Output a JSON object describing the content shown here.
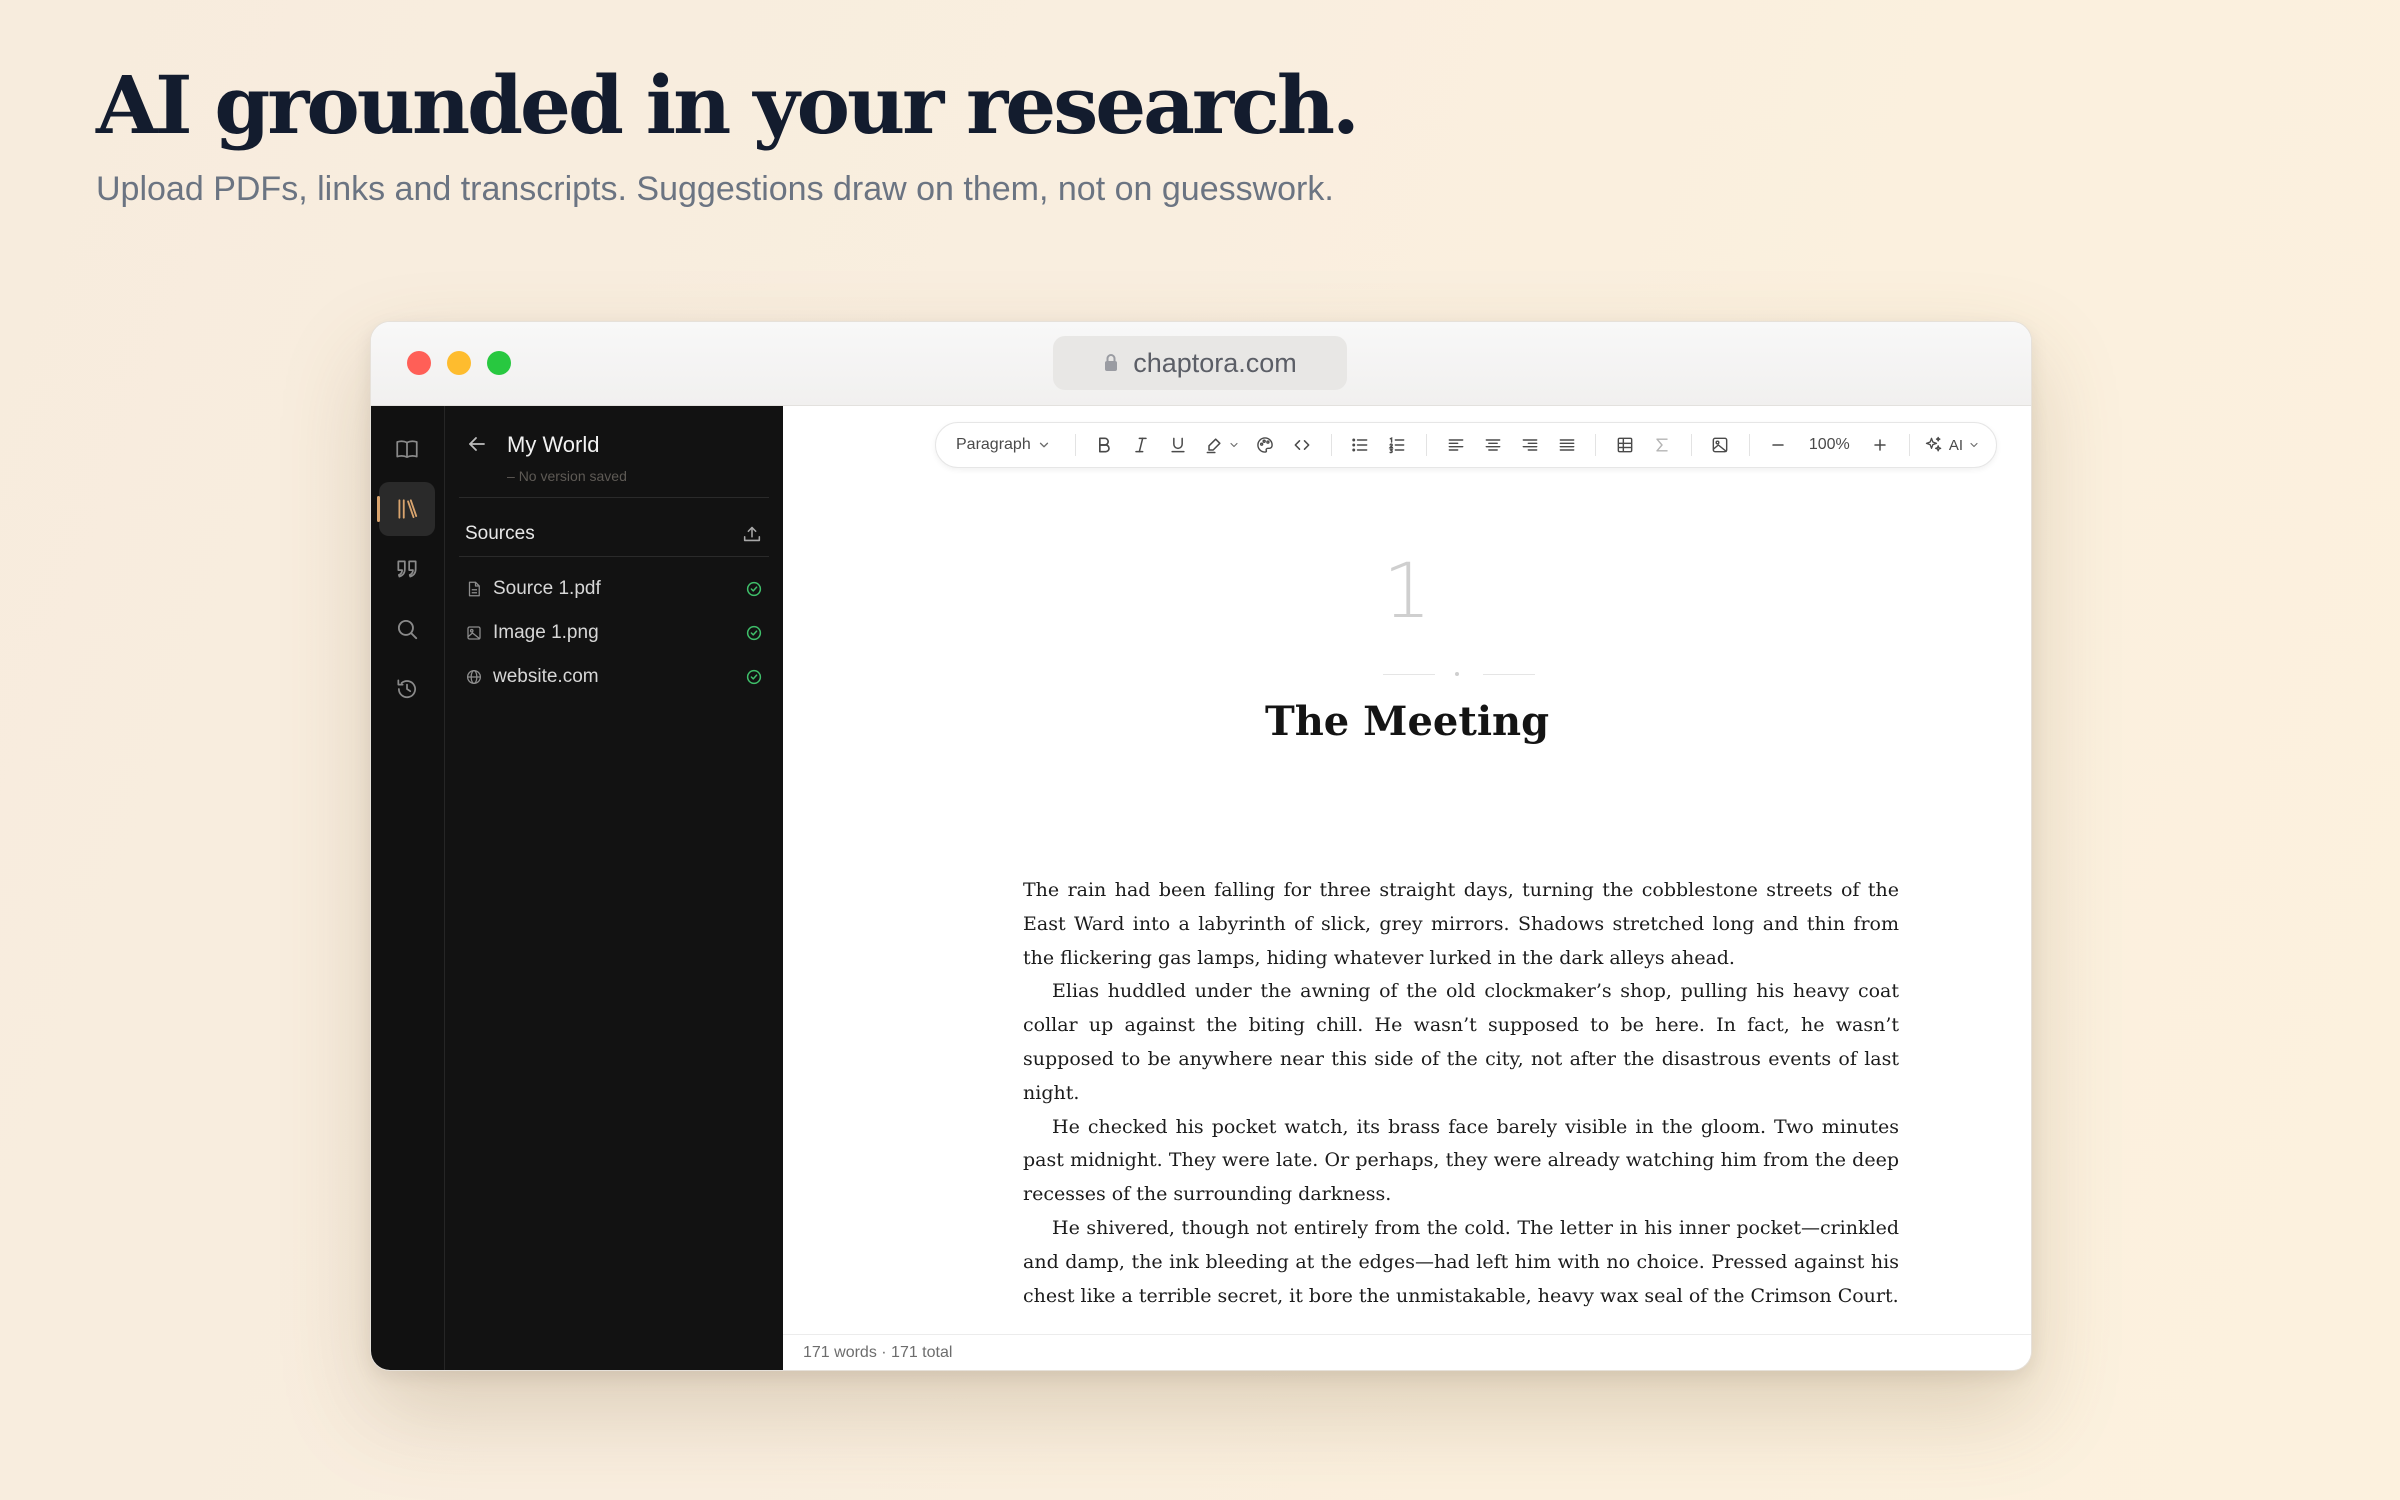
{
  "hero": {
    "title": "AI grounded in your research.",
    "subtitle": "Upload PDFs, links and transcripts. Suggestions draw on them, not on guesswork."
  },
  "browser": {
    "url": "chaptora.com"
  },
  "rail": {
    "items": [
      {
        "name": "book-icon"
      },
      {
        "name": "library-icon",
        "active": true
      },
      {
        "name": "quote-icon"
      },
      {
        "name": "search-icon"
      },
      {
        "name": "history-icon"
      }
    ]
  },
  "sidebar": {
    "project_title": "My World",
    "version_note": "No version saved",
    "sources_label": "Sources",
    "sources": [
      {
        "name": "Source 1.pdf",
        "icon": "file-icon"
      },
      {
        "name": "Image 1.png",
        "icon": "image-icon"
      },
      {
        "name": "website.com",
        "icon": "globe-icon"
      }
    ]
  },
  "toolbar": {
    "block_style": "Paragraph",
    "zoom": "100%",
    "ai_label": "AI"
  },
  "document": {
    "chapter_number": "1",
    "chapter_title": "The Meeting",
    "paragraphs": [
      "The rain had been falling for three straight days, turning the cobblestone streets of the East Ward into a labyrinth of slick, grey mirrors. Shadows stretched long and thin from the flickering gas lamps, hiding whatever lurked in the dark alleys ahead.",
      "Elias huddled under the awning of the old clockmaker’s shop, pulling his heavy coat collar up against the biting chill. He wasn’t supposed to be here. In fact, he wasn’t supposed to be anywhere near this side of the city, not after the disastrous events of last night.",
      "He checked his pocket watch, its brass face barely visible in the gloom. Two minutes past midnight. They were late. Or perhaps, they were already watching him from the deep recesses of the surrounding darkness.",
      "He shivered, though not entirely from the cold. The letter in his inner pocket—crinkled and damp, the ink bleeding at the edges—had left him with no choice. Pressed against his chest like a terrible secret, it bore the unmistakable, heavy wax seal of the Crimson Court."
    ]
  },
  "status": {
    "word_count": "171 words · 171 total"
  },
  "colors": {
    "accent": "#d9a46e",
    "check_green": "#3fbf6a"
  }
}
